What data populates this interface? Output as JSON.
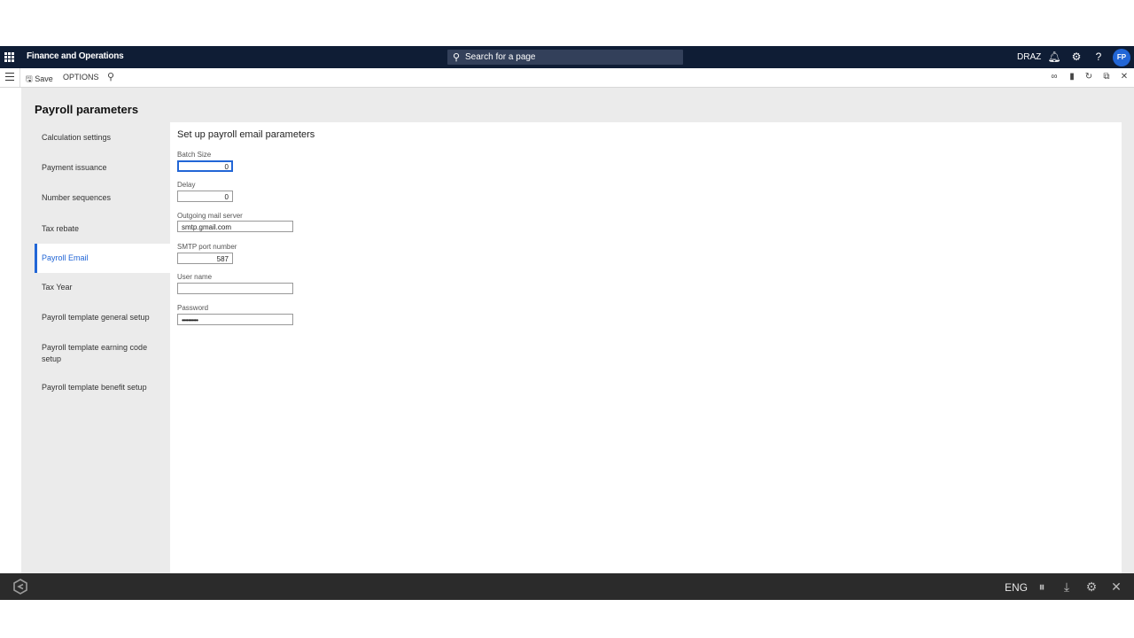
{
  "navbar": {
    "app_title": "Finance and Operations",
    "search_placeholder": "Search for a page",
    "company": "DRAZ",
    "avatar_initials": "FP",
    "icons": [
      "waffle-icon",
      "bell-icon",
      "gear-icon",
      "help-icon"
    ]
  },
  "actionpane": {
    "save_label": "Save",
    "options_label": "OPTIONS",
    "icons": [
      "hamburger-icon",
      "save-icon",
      "search-icon",
      "link-icon",
      "office-icon",
      "refresh-icon",
      "popout-icon",
      "close-icon"
    ]
  },
  "page": {
    "title": "Payroll parameters"
  },
  "nav": {
    "items": [
      {
        "label": "Calculation settings"
      },
      {
        "label": "Payment issuance"
      },
      {
        "label": "Number sequences"
      },
      {
        "label": "Tax rebate"
      },
      {
        "label": "Payroll Email",
        "active": true
      },
      {
        "label": "Tax Year"
      },
      {
        "label": "Payroll template general setup"
      },
      {
        "label": "Payroll template earning code setup"
      },
      {
        "label": "Payroll template benefit setup"
      }
    ]
  },
  "form": {
    "section_title": "Set up payroll email parameters",
    "batch_size_label": "Batch Size",
    "batch_size_value": "0",
    "delay_label": "Delay",
    "delay_value": "0",
    "mail_server_label": "Outgoing mail server",
    "mail_server_value": "smtp.gmail.com",
    "smtp_port_label": "SMTP port number",
    "smtp_port_value": "587",
    "username_label": "User name",
    "username_value": "",
    "password_label": "Password",
    "password_value": "••••••••••"
  },
  "taskbar": {
    "language": "ENG",
    "icons": [
      "app-logo-icon",
      "pause-icon",
      "download-icon",
      "settings-icon",
      "close-icon"
    ]
  },
  "colors": {
    "navbar_bg": "#0f1d35",
    "accent": "#2266d6",
    "taskbar_bg": "#2b2b2b",
    "workspace_bg": "#ebebeb"
  }
}
